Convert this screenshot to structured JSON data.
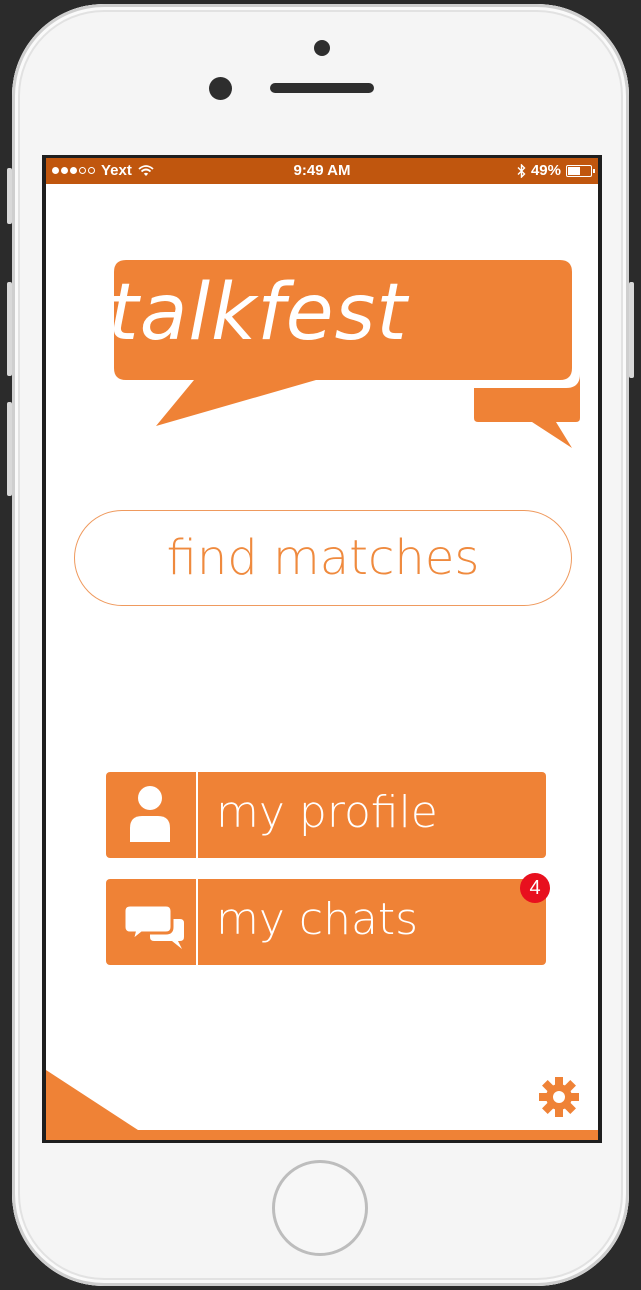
{
  "status_bar": {
    "carrier": "Yext",
    "time": "9:49 AM",
    "battery": "49%",
    "battery_level": 0.49,
    "signal_bars_filled": 3,
    "signal_bars_total": 5
  },
  "logo": {
    "text": "talkfest"
  },
  "find_matches": {
    "label": "find matches"
  },
  "menu": {
    "profile_label": "my profile",
    "chats_label": "my chats",
    "chats_badge": "4"
  },
  "icons": {
    "profile": "person-icon",
    "chats": "chat-bubbles-icon",
    "settings": "gear-icon",
    "bluetooth": "bluetooth-icon",
    "wifi": "wifi-icon",
    "battery": "battery-icon"
  },
  "colors": {
    "brand_orange": "#ef8236",
    "status_bar": "#c0560e",
    "badge_red": "#e8101e"
  }
}
